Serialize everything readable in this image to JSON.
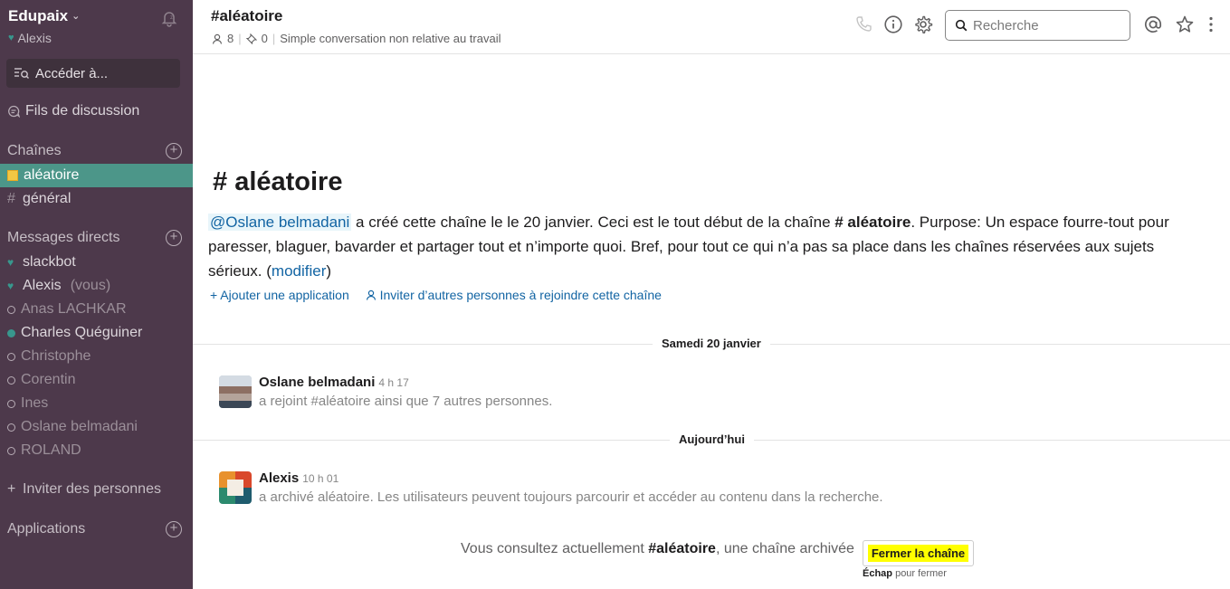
{
  "workspace": {
    "name": "Edupaix",
    "user": "Alexis"
  },
  "sidebar": {
    "jump_label": "Accéder à...",
    "threads_label": "Fils de discussion",
    "channels_heading": "Chaînes",
    "channels": [
      {
        "label": "aléatoire",
        "active": true,
        "archived": true
      },
      {
        "label": "général",
        "active": false
      }
    ],
    "dm_heading": "Messages directs",
    "dms": [
      {
        "label": "slackbot",
        "suffix": ""
      },
      {
        "label": "Alexis",
        "suffix": "(vous)"
      },
      {
        "label": "Anas LACHKAR",
        "suffix": ""
      },
      {
        "label": "Charles Quéguiner",
        "suffix": ""
      },
      {
        "label": "Christophe",
        "suffix": ""
      },
      {
        "label": "Corentin",
        "suffix": ""
      },
      {
        "label": "Ines",
        "suffix": ""
      },
      {
        "label": "Oslane belmadani",
        "suffix": ""
      },
      {
        "label": "ROLAND",
        "suffix": ""
      }
    ],
    "invite_label": "Inviter des personnes",
    "apps_heading": "Applications"
  },
  "header": {
    "title": "#aléatoire",
    "members": "8",
    "pins": "0",
    "topic": "Simple conversation non relative au travail",
    "search_placeholder": "Recherche"
  },
  "intro": {
    "title": "aléatoire",
    "mention": "@Oslane belmadani",
    "text1": " a créé cette chaîne le le 20 janvier. Ceci est le tout début de la chaîne ",
    "channel": "# aléatoire",
    "text2": ". Purpose: Un espace fourre-tout pour paresser, blaguer, bavarder et partager tout et n’importe quoi. Bref, pour tout ce qui n’a pas sa place dans les chaînes réservées aux sujets sérieux. (",
    "modify": "modifier",
    "text3": ")",
    "add_app": "Ajouter une application",
    "invite": "Inviter d’autres personnes à rejoindre cette chaîne"
  },
  "messages": {
    "day1": "Samedi 20 janvier",
    "msg1": {
      "author": "Oslane belmadani",
      "time": "4 h 17",
      "text": "a rejoint #aléatoire ainsi que 7 autres personnes."
    },
    "day2": "Aujourd’hui",
    "msg2": {
      "author": "Alexis",
      "time": "10 h 01",
      "text": "a archivé aléatoire. Les utilisateurs peuvent toujours parcourir et accéder au contenu dans la recherche."
    }
  },
  "archived": {
    "prefix": "Vous consultez actuellement ",
    "channel": "#aléatoire",
    "suffix": ", une chaîne archivée",
    "close_label": "Fermer la chaîne",
    "esc_key": "Échap",
    "esc_text": " pour fermer"
  }
}
